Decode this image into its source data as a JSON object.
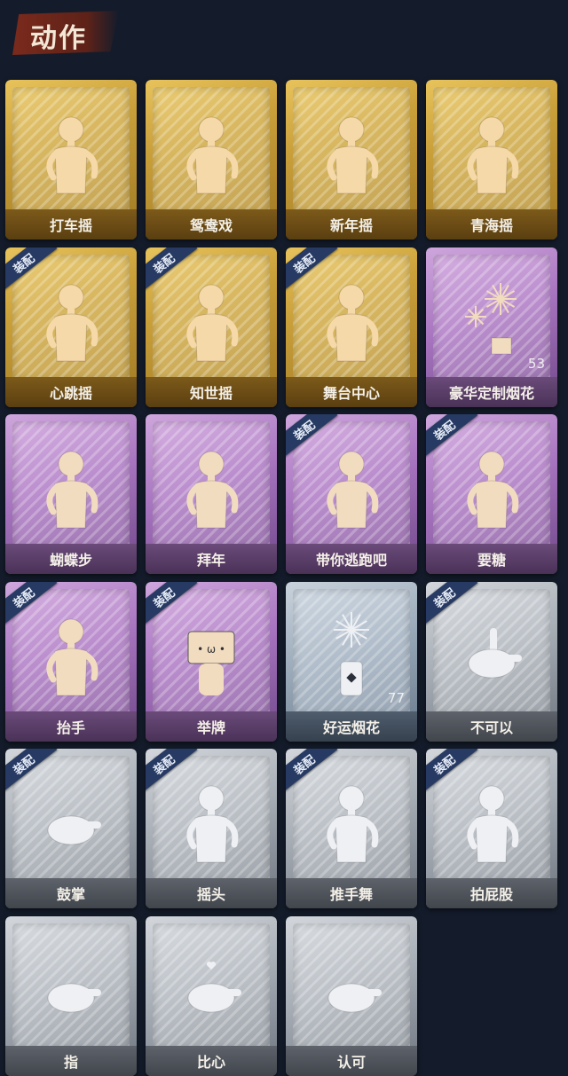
{
  "header": {
    "title": "动作"
  },
  "badge_text": "装配",
  "cards": [
    {
      "label": "打车摇",
      "tier": "gold",
      "equipped": false,
      "icon": "dance-figure-icon"
    },
    {
      "label": "鸳鸯戏",
      "tier": "gold",
      "equipped": false,
      "icon": "dance-figure-icon"
    },
    {
      "label": "新年摇",
      "tier": "gold",
      "equipped": false,
      "icon": "dance-figure-icon"
    },
    {
      "label": "青海摇",
      "tier": "gold",
      "equipped": false,
      "icon": "dance-figure-icon"
    },
    {
      "label": "心跳摇",
      "tier": "gold",
      "equipped": true,
      "icon": "dance-figure-icon"
    },
    {
      "label": "知世摇",
      "tier": "gold",
      "equipped": true,
      "icon": "dance-figure-icon"
    },
    {
      "label": "舞台中心",
      "tier": "gold",
      "equipped": true,
      "icon": "dance-figure-icon"
    },
    {
      "label": "豪华定制烟花",
      "tier": "purple",
      "equipped": false,
      "icon": "fireworks-icon",
      "count": "53"
    },
    {
      "label": "蝴蝶步",
      "tier": "purple",
      "equipped": false,
      "icon": "dance-figure-icon"
    },
    {
      "label": "拜年",
      "tier": "purple",
      "equipped": false,
      "icon": "bow-figure-icon"
    },
    {
      "label": "带你逃跑吧",
      "tier": "purple",
      "equipped": true,
      "icon": "dance-figure-icon"
    },
    {
      "label": "要糖",
      "tier": "purple",
      "equipped": true,
      "icon": "figure-icon"
    },
    {
      "label": "抬手",
      "tier": "purple",
      "equipped": true,
      "icon": "figure-icon"
    },
    {
      "label": "举牌",
      "tier": "purple",
      "equipped": true,
      "icon": "sign-figure-icon"
    },
    {
      "label": "好运烟花",
      "tier": "silverblue",
      "equipped": false,
      "icon": "firecracker-icon",
      "count": "77"
    },
    {
      "label": "不可以",
      "tier": "gray",
      "equipped": true,
      "icon": "finger-wag-icon"
    },
    {
      "label": "鼓掌",
      "tier": "gray",
      "equipped": true,
      "icon": "clap-hands-icon"
    },
    {
      "label": "摇头",
      "tier": "gray",
      "equipped": true,
      "icon": "figure-icon"
    },
    {
      "label": "推手舞",
      "tier": "gray",
      "equipped": true,
      "icon": "figure-icon"
    },
    {
      "label": "拍屁股",
      "tier": "gray",
      "equipped": true,
      "icon": "figure-icon"
    },
    {
      "label": "指",
      "tier": "gray",
      "equipped": false,
      "icon": "point-hand-icon"
    },
    {
      "label": "比心",
      "tier": "gray",
      "equipped": false,
      "icon": "heart-hand-icon"
    },
    {
      "label": "认可",
      "tier": "gray",
      "equipped": false,
      "icon": "thumbs-up-icon"
    }
  ]
}
